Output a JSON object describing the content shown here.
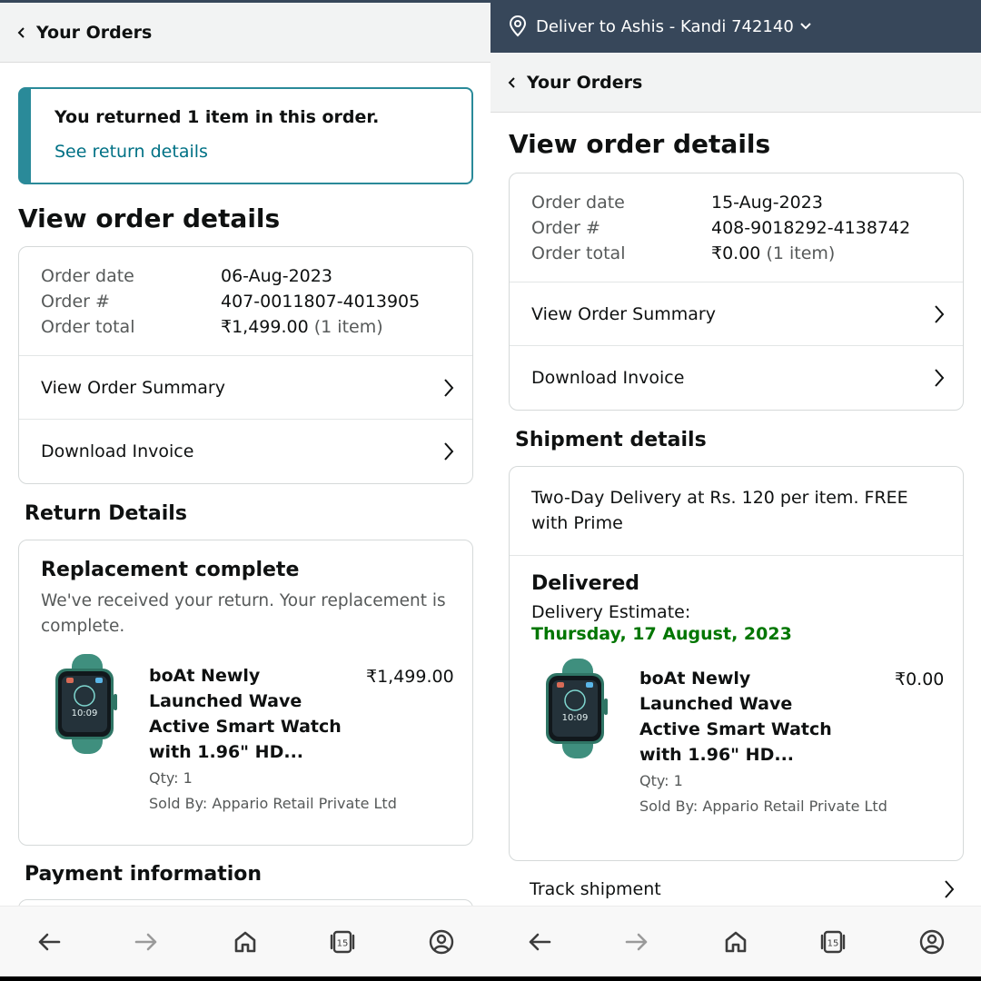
{
  "left": {
    "header": {
      "title": "Your Orders"
    },
    "notice": {
      "message": "You returned 1 item in this order.",
      "link": "See return details"
    },
    "view_order_heading": "View order details",
    "order": {
      "date_label": "Order date",
      "date": "06-Aug-2023",
      "number_label": "Order #",
      "number": "407-0011807-4013905",
      "total_label": "Order total",
      "total": "₹1,499.00",
      "total_items": "(1 item)"
    },
    "links": {
      "summary": "View Order Summary",
      "invoice": "Download Invoice"
    },
    "return_heading": "Return Details",
    "return": {
      "status": "Replacement complete",
      "message": "We've received your return. Your replacement is complete."
    },
    "item": {
      "name": "boAt Newly Launched Wave Active Smart Watch with 1.96\" HD...",
      "price": "₹1,499.00",
      "qty": "Qty: 1",
      "seller": "Sold By: Appario Retail Private Ltd",
      "watch_time": "10:09"
    },
    "payment_heading": "Payment information"
  },
  "right": {
    "deliver_bar": {
      "text": "Deliver to Ashis - Kandi 742140"
    },
    "header": {
      "title": "Your Orders"
    },
    "view_order_heading": "View order details",
    "order": {
      "date_label": "Order date",
      "date": "15-Aug-2023",
      "number_label": "Order #",
      "number": "408-9018292-4138742",
      "total_label": "Order total",
      "total": "₹0.00",
      "total_items": "(1 item)"
    },
    "links": {
      "summary": "View Order Summary",
      "invoice": "Download Invoice"
    },
    "shipment_heading": "Shipment details",
    "shipment": {
      "method": "Two-Day Delivery at Rs. 120 per item. FREE with Prime",
      "status": "Delivered",
      "estimate_label": "Delivery Estimate:",
      "estimate_date": "Thursday, 17 August, 2023"
    },
    "item": {
      "name": "boAt Newly Launched Wave Active Smart Watch with 1.96\" HD...",
      "price": "₹0.00",
      "qty": "Qty: 1",
      "seller": "Sold By: Appario Retail Private Ltd",
      "watch_time": "10:09"
    },
    "track_label": "Track shipment"
  },
  "navbar": {
    "tab_count": "15"
  },
  "colors": {
    "link": "#007185",
    "notice_border": "#2a8a99",
    "delivery_green": "#007600",
    "header_dark": "#37475a"
  },
  "icons": [
    "back-chevron-icon",
    "location-pin-icon",
    "chevron-down-icon",
    "chevron-right-icon",
    "nav-back-arrow-icon",
    "nav-forward-arrow-icon",
    "home-icon",
    "tabs-icon",
    "profile-icon"
  ]
}
